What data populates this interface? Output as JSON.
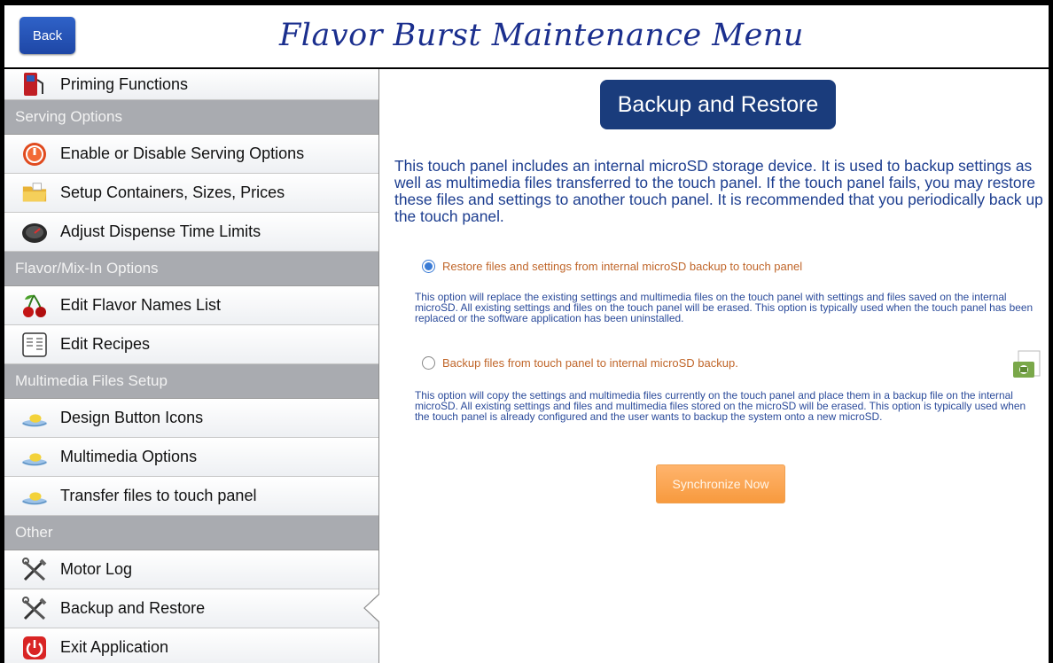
{
  "header": {
    "back_label": "Back",
    "title": "Flavor Burst Maintenance Menu"
  },
  "sidebar": {
    "items": [
      {
        "type": "item",
        "label": "Priming Functions",
        "icon": "fuel-pump-icon"
      },
      {
        "type": "section",
        "label": "Serving Options"
      },
      {
        "type": "item",
        "label": "Enable or Disable Serving Options",
        "icon": "power-red-icon"
      },
      {
        "type": "item",
        "label": "Setup Containers, Sizes, Prices",
        "icon": "folder-icon"
      },
      {
        "type": "item",
        "label": "Adjust Dispense Time Limits",
        "icon": "gauge-icon"
      },
      {
        "type": "section",
        "label": "Flavor/Mix-In Options"
      },
      {
        "type": "item",
        "label": "Edit Flavor Names List",
        "icon": "cherry-icon"
      },
      {
        "type": "item",
        "label": "Edit Recipes",
        "icon": "recipe-icon"
      },
      {
        "type": "section",
        "label": "Multimedia Files Setup"
      },
      {
        "type": "item",
        "label": "Design Button Icons",
        "icon": "tray-icon"
      },
      {
        "type": "item",
        "label": "Multimedia Options",
        "icon": "tray-icon"
      },
      {
        "type": "item",
        "label": "Transfer files to touch panel",
        "icon": "tray-icon"
      },
      {
        "type": "section",
        "label": "Other"
      },
      {
        "type": "item",
        "label": "Motor Log",
        "icon": "tools-icon"
      },
      {
        "type": "item",
        "label": "Backup and Restore",
        "icon": "tools-icon",
        "selected": true
      },
      {
        "type": "item",
        "label": "Exit Application",
        "icon": "power-icon"
      }
    ]
  },
  "content": {
    "title": "Backup and Restore",
    "intro": "This touch panel includes an internal microSD storage device. It is used to backup settings as well as multimedia files transferred to the touch panel. If the touch panel fails, you may restore these files and settings to another touch panel. It is recommended that you periodically back up the touch panel.",
    "options": [
      {
        "label": "Restore files and settings from internal microSD backup to touch panel",
        "checked": true,
        "description": "This option will replace the existing settings and multimedia files on the touch panel with settings and files saved on the internal microSD. All existing settings and files on the touch panel will be erased. This option is typically used when the touch panel has been replaced or the software application has been uninstalled."
      },
      {
        "label": "Backup files from touch panel to internal microSD backup.",
        "checked": false,
        "description": "This option will copy the settings and multimedia files currently on the touch panel and place them in a backup file on the internal microSD. All existing settings and files and multimedia files stored on the microSD will be erased. This option is typically used when the touch panel is already configured and the user wants to backup the system onto a new microSD."
      }
    ],
    "sync_label": "Synchronize Now",
    "sd_icon": "sd-card-icon"
  },
  "colors": {
    "title_blue": "#1b2f8e",
    "content_title_bg": "#1a3c7c",
    "option_orange": "#c0662a",
    "sync_orange": "#f79a3e",
    "section_gray": "#a9abb0"
  }
}
